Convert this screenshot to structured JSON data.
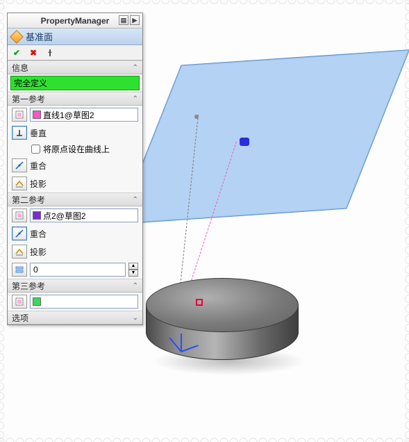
{
  "title": "PropertyManager",
  "feature": {
    "name": "基准面"
  },
  "sections": {
    "info": {
      "header": "信息",
      "status": "完全定义"
    },
    "ref1": {
      "header": "第一参考",
      "selection": "直线1@草图2",
      "perpendicular": "垂直",
      "origin_on_curve": "将原点设在曲线上",
      "coincident": "重合",
      "project": "投影"
    },
    "ref2": {
      "header": "第二参考",
      "selection": "点2@草图2",
      "coincident": "重合",
      "project": "投影",
      "offset": "0"
    },
    "ref3": {
      "header": "第三参考",
      "selection": ""
    },
    "options": {
      "header": "选项"
    }
  }
}
